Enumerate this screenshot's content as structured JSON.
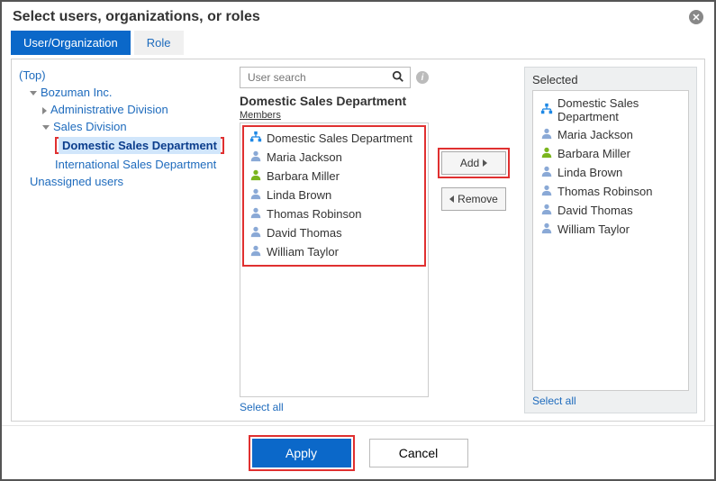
{
  "title": "Select users, organizations, or roles",
  "tabs": {
    "user_org": "User/Organization",
    "role": "Role"
  },
  "tree": {
    "top": "(Top)",
    "org": "Bozuman Inc.",
    "admin_div": "Administrative Division",
    "sales_div": "Sales Division",
    "dom_sales": "Domestic Sales Department",
    "intl_sales": "International Sales Department",
    "unassigned": "Unassigned users"
  },
  "search": {
    "placeholder": "User search"
  },
  "middle": {
    "title": "Domestic Sales Department",
    "subtitle": "Members",
    "items": [
      {
        "type": "org",
        "label": "Domestic Sales Department"
      },
      {
        "type": "user",
        "label": "Maria Jackson"
      },
      {
        "type": "user-green",
        "label": "Barbara Miller"
      },
      {
        "type": "user",
        "label": "Linda Brown"
      },
      {
        "type": "user",
        "label": "Thomas Robinson"
      },
      {
        "type": "user",
        "label": "David Thomas"
      },
      {
        "type": "user",
        "label": "William Taylor"
      }
    ],
    "select_all": "Select all"
  },
  "transfer": {
    "add": "Add",
    "remove": "Remove"
  },
  "selected": {
    "title": "Selected",
    "items": [
      {
        "type": "org",
        "label": "Domestic Sales Department"
      },
      {
        "type": "user",
        "label": "Maria Jackson"
      },
      {
        "type": "user-green",
        "label": "Barbara Miller"
      },
      {
        "type": "user",
        "label": "Linda Brown"
      },
      {
        "type": "user",
        "label": "Thomas Robinson"
      },
      {
        "type": "user",
        "label": "David Thomas"
      },
      {
        "type": "user",
        "label": "William Taylor"
      }
    ],
    "select_all": "Select all"
  },
  "footer": {
    "apply": "Apply",
    "cancel": "Cancel"
  }
}
